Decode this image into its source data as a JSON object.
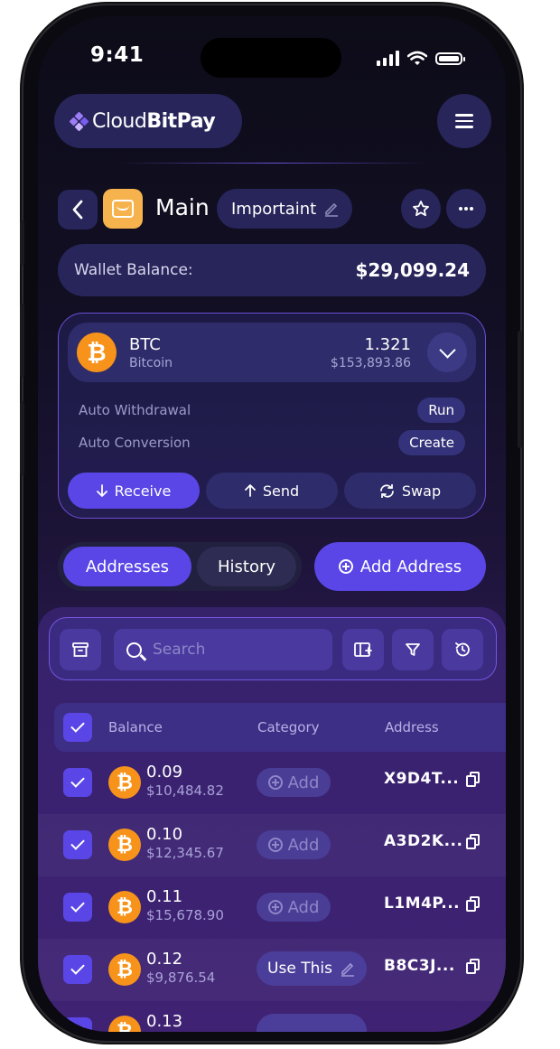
{
  "status": {
    "time": "9:41"
  },
  "brand": {
    "name_light": "Cloud",
    "name_bold": "BitPay"
  },
  "wallet": {
    "name": "Main",
    "tag": "Importaint"
  },
  "balance": {
    "label": "Wallet Balance:",
    "value": "$29,099.24"
  },
  "coin": {
    "symbol": "BTC",
    "name": "Bitcoin",
    "amount": "1.321",
    "fiat": "$153,893.86",
    "icon_glyph": "₿",
    "auto_withdrawal_label": "Auto Withdrawal",
    "auto_withdrawal_action": "Run",
    "auto_conversion_label": "Auto Conversion",
    "auto_conversion_action": "Create"
  },
  "actions": {
    "receive": "Receive",
    "send": "Send",
    "swap": "Swap"
  },
  "tabs": {
    "addresses": "Addresses",
    "history": "History",
    "active": "addresses"
  },
  "add_address": "Add Address",
  "search": {
    "placeholder": "Search",
    "value": ""
  },
  "table": {
    "headers": {
      "balance": "Balance",
      "category": "Category",
      "address": "Address"
    },
    "rows": [
      {
        "amount": "0.09",
        "fiat": "$10,484.82",
        "category": "Add",
        "address": "X9D4T..."
      },
      {
        "amount": "0.10",
        "fiat": "$12,345.67",
        "category": "Add",
        "address": "A3D2K..."
      },
      {
        "amount": "0.11",
        "fiat": "$15,678.90",
        "category": "Add",
        "address": "L1M4P..."
      },
      {
        "amount": "0.12",
        "fiat": "$9,876.54",
        "category": "Use This",
        "address": "B8C3J..."
      },
      {
        "amount": "0.13",
        "fiat": "",
        "category": "",
        "address": ""
      }
    ]
  },
  "colors": {
    "accent": "#5a46e6",
    "bitcoin": "#f7931a",
    "wallet_icon": "#f6b34d",
    "panel": "#27255a"
  },
  "icons": [
    "signal-icon",
    "wifi-icon",
    "battery-icon",
    "menu-icon",
    "back-icon",
    "wallet-icon",
    "pencil-icon",
    "star-icon",
    "more-icon",
    "bitcoin-icon",
    "chevron-down-icon",
    "arrow-down-icon",
    "arrow-up-icon",
    "swap-icon",
    "plus-circle-icon",
    "archive-icon",
    "search-icon",
    "columns-icon",
    "filter-icon",
    "history-icon",
    "check-icon",
    "copy-icon"
  ]
}
